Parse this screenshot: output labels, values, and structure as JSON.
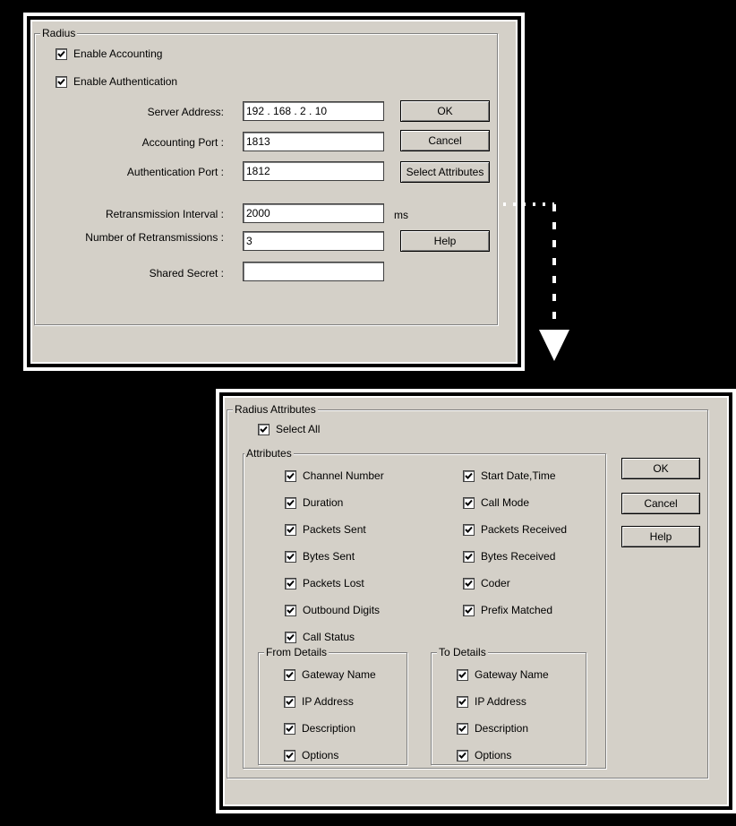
{
  "radius": {
    "group_label": "Radius",
    "enable_accounting": "Enable Accounting",
    "enable_authentication": "Enable Authentication",
    "server_address_label": "Server Address:",
    "server_address_value": "192 . 168 .  2  .  10",
    "accounting_port_label": "Accounting Port :",
    "accounting_port_value": "1813",
    "authentication_port_label": "Authentication Port :",
    "authentication_port_value": "1812",
    "retransmission_interval_label": "Retransmission Interval :",
    "retransmission_interval_value": "2000",
    "retransmission_interval_unit": "ms",
    "num_retransmissions_label": "Number of Retransmissions :",
    "num_retransmissions_value": "3",
    "shared_secret_label": "Shared Secret  :",
    "shared_secret_value": "",
    "ok_label": "OK",
    "cancel_label": "Cancel",
    "select_attributes_label": "Select Attributes",
    "help_label": "Help"
  },
  "attributes_dialog": {
    "group_label": "Radius Attributes",
    "select_all": "Select All",
    "attributes_group_label": "Attributes",
    "left_items": [
      "Channel Number",
      "Duration",
      "Packets Sent",
      "Bytes Sent",
      "Packets Lost",
      "Outbound Digits",
      "Call Status"
    ],
    "right_items": [
      "Start Date,Time",
      "Call Mode",
      "Packets Received",
      "Bytes Received",
      "Coder",
      "Prefix Matched"
    ],
    "from_details_label": "From Details",
    "from_items": [
      "Gateway Name",
      "IP Address",
      "Description",
      "Options"
    ],
    "to_details_label": "To Details",
    "to_items": [
      "Gateway Name",
      "IP Address",
      "Description",
      "Options"
    ],
    "ok_label": "OK",
    "cancel_label": "Cancel",
    "help_label": "Help"
  }
}
